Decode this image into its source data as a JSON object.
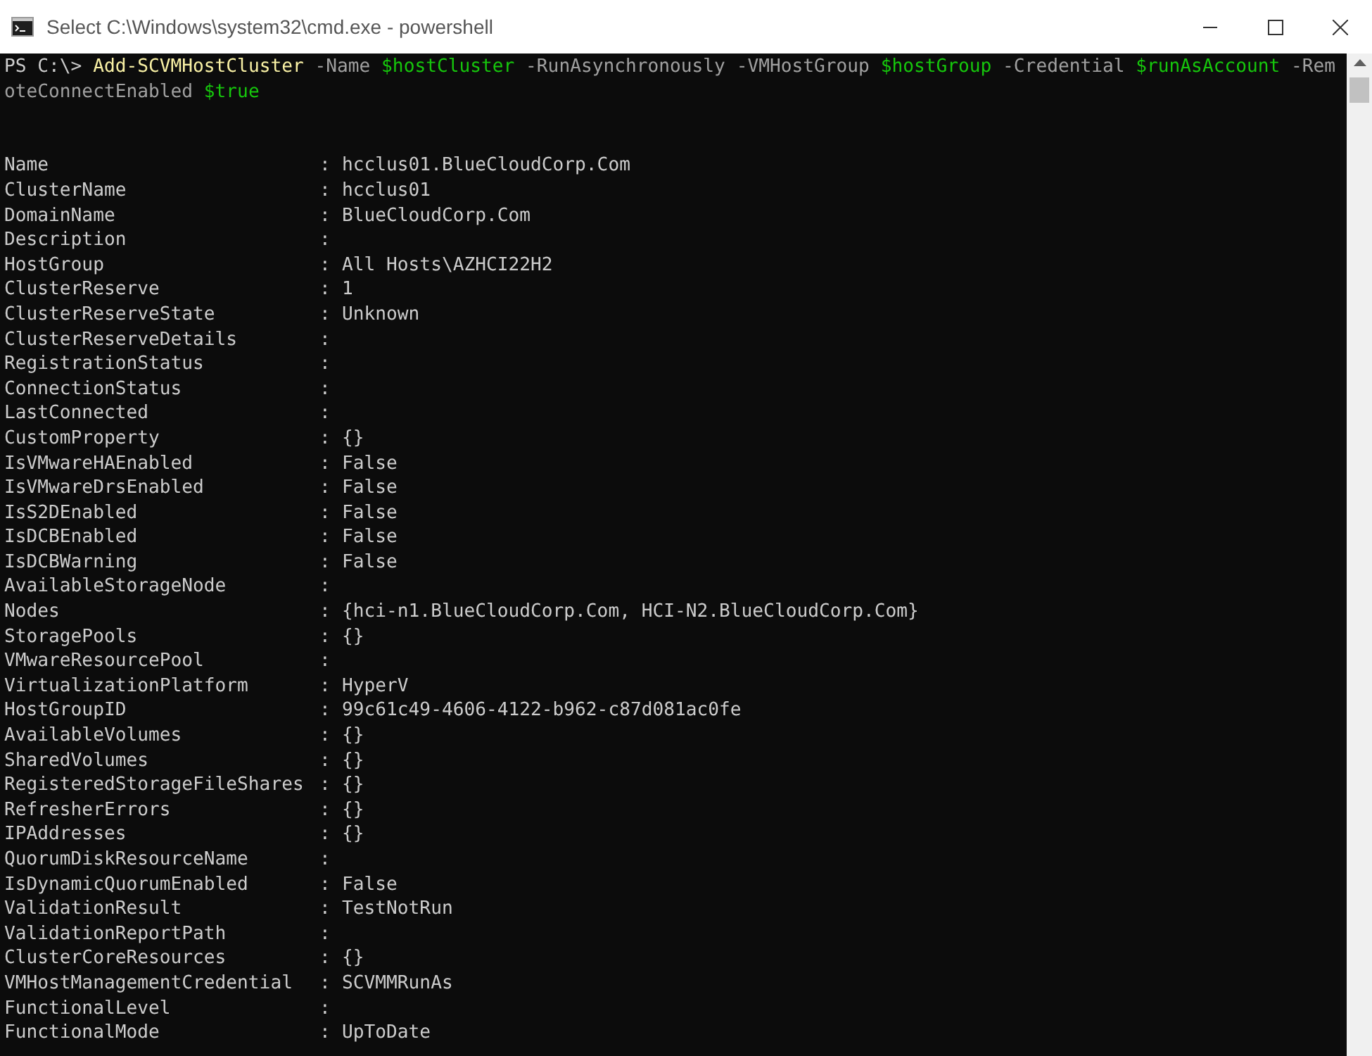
{
  "window": {
    "title": "Select C:\\Windows\\system32\\cmd.exe - powershell"
  },
  "command_lines": [
    [
      {
        "kind": "prompt",
        "text": "PS C:\\> "
      },
      {
        "kind": "command",
        "text": "Add-SCVMHostCluster"
      },
      {
        "kind": "parameter",
        "text": " -Name "
      },
      {
        "kind": "variable",
        "text": "$hostCluster"
      },
      {
        "kind": "parameter",
        "text": " -RunAsynchronously -VMHostGroup "
      },
      {
        "kind": "variable",
        "text": "$hostGroup"
      },
      {
        "kind": "parameter",
        "text": " -Credential "
      },
      {
        "kind": "variable",
        "text": "$runAsAccount"
      },
      {
        "kind": "parameter",
        "text": " -Rem"
      }
    ],
    [
      {
        "kind": "parameter",
        "text": "oteConnectEnabled "
      },
      {
        "kind": "variable",
        "text": "$true"
      }
    ]
  ],
  "properties": [
    {
      "name": "Name",
      "separator": ":",
      "value": "hcclus01.BlueCloudCorp.Com"
    },
    {
      "name": "ClusterName",
      "separator": ":",
      "value": "hcclus01"
    },
    {
      "name": "DomainName",
      "separator": ":",
      "value": "BlueCloudCorp.Com"
    },
    {
      "name": "Description",
      "separator": ":"
    },
    {
      "name": "HostGroup",
      "separator": ":",
      "value": "All Hosts\\AZHCI22H2"
    },
    {
      "name": "ClusterReserve",
      "separator": ":",
      "value": "1"
    },
    {
      "name": "ClusterReserveState",
      "separator": ":",
      "value": "Unknown"
    },
    {
      "name": "ClusterReserveDetails",
      "separator": ":"
    },
    {
      "name": "RegistrationStatus",
      "separator": ":"
    },
    {
      "name": "ConnectionStatus",
      "separator": ":"
    },
    {
      "name": "LastConnected",
      "separator": ":"
    },
    {
      "name": "CustomProperty",
      "separator": ":",
      "value": "{}"
    },
    {
      "name": "IsVMwareHAEnabled",
      "separator": ":",
      "value": "False"
    },
    {
      "name": "IsVMwareDrsEnabled",
      "separator": ":",
      "value": "False"
    },
    {
      "name": "IsS2DEnabled",
      "separator": ":",
      "value": "False"
    },
    {
      "name": "IsDCBEnabled",
      "separator": ":",
      "value": "False"
    },
    {
      "name": "IsDCBWarning",
      "separator": ":",
      "value": "False"
    },
    {
      "name": "AvailableStorageNode",
      "separator": ":"
    },
    {
      "name": "Nodes",
      "separator": ":",
      "value": "{hci-n1.BlueCloudCorp.Com, HCI-N2.BlueCloudCorp.Com}"
    },
    {
      "name": "StoragePools",
      "separator": ":",
      "value": "{}"
    },
    {
      "name": "VMwareResourcePool",
      "separator": ":"
    },
    {
      "name": "VirtualizationPlatform",
      "separator": ":",
      "value": "HyperV"
    },
    {
      "name": "HostGroupID",
      "separator": ":",
      "value": "99c61c49-4606-4122-b962-c87d081ac0fe"
    },
    {
      "name": "AvailableVolumes",
      "separator": ":",
      "value": "{}"
    },
    {
      "name": "SharedVolumes",
      "separator": ":",
      "value": "{}"
    },
    {
      "name": "RegisteredStorageFileShares",
      "separator": ":",
      "value": "{}"
    },
    {
      "name": "RefresherErrors",
      "separator": ":",
      "value": "{}"
    },
    {
      "name": "IPAddresses",
      "separator": ":",
      "value": "{}"
    },
    {
      "name": "QuorumDiskResourceName",
      "separator": ":"
    },
    {
      "name": "IsDynamicQuorumEnabled",
      "separator": ":",
      "value": "False"
    },
    {
      "name": "ValidationResult",
      "separator": ":",
      "value": "TestNotRun"
    },
    {
      "name": "ValidationReportPath",
      "separator": ":"
    },
    {
      "name": "ClusterCoreResources",
      "separator": ":",
      "value": "{}"
    },
    {
      "name": "VMHostManagementCredential",
      "separator": ":",
      "value": "SCVMMRunAs"
    },
    {
      "name": "FunctionalLevel",
      "separator": ":"
    },
    {
      "name": "FunctionalMode",
      "separator": ":",
      "value": "UpToDate"
    }
  ]
}
